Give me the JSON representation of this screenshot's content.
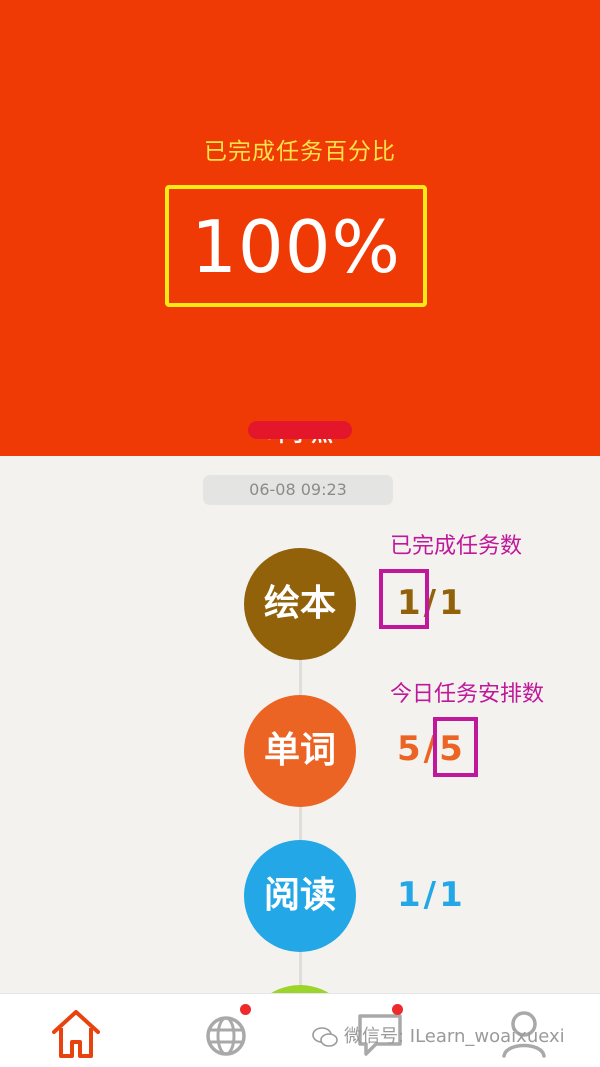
{
  "header": {
    "completion_label": "已完成任务百分比",
    "completion_percent": "100%",
    "user_name": "叶子杰"
  },
  "timestamp": "06-08  09:23",
  "tasks": [
    {
      "name": "绘本",
      "done": "1",
      "total": "1",
      "color": "#92620a"
    },
    {
      "name": "单词",
      "done": "5",
      "total": "5",
      "color": "#ec6424"
    },
    {
      "name": "阅读",
      "done": "1",
      "total": "1",
      "color": "#24a7e6"
    }
  ],
  "annotations": {
    "completed_count_label": "已完成任务数",
    "scheduled_count_label": "今日任务安排数"
  },
  "nav": {
    "items": [
      "home-icon",
      "globe-icon",
      "chat-icon",
      "profile-icon"
    ],
    "active_color": "#e8420e"
  },
  "watermark": {
    "text": "微信号: ILearn_woaixuexi"
  }
}
